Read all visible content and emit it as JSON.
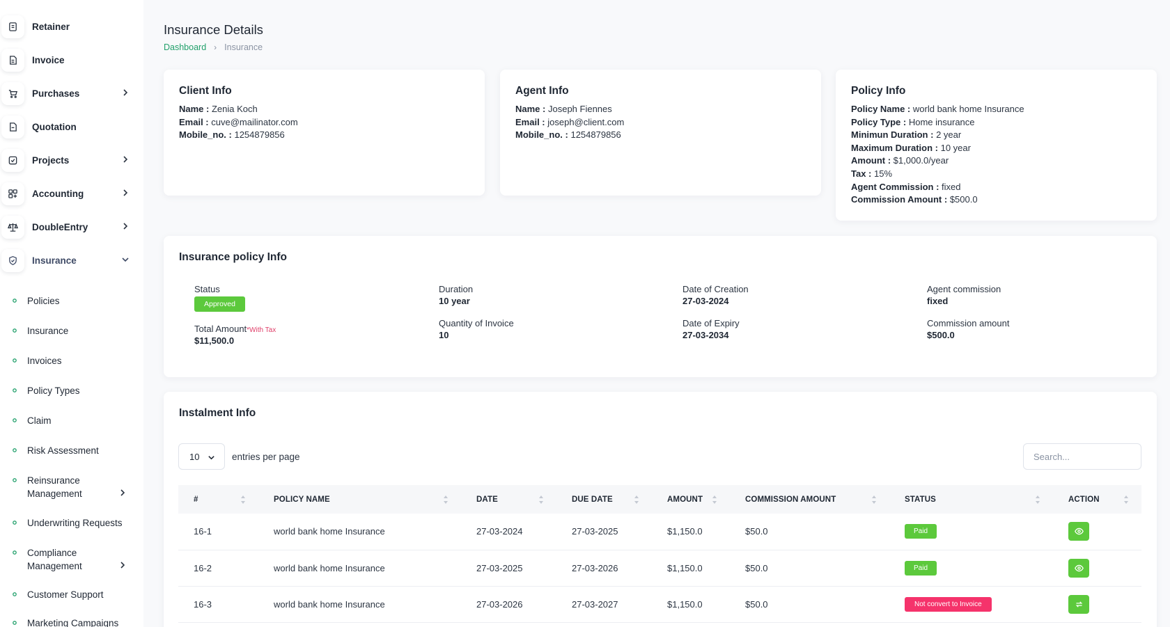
{
  "sidebar": {
    "items": [
      {
        "label": "Retainer",
        "icon": "retainer-icon"
      },
      {
        "label": "Invoice",
        "icon": "invoice-icon"
      },
      {
        "label": "Purchases",
        "icon": "cart-icon"
      },
      {
        "label": "Quotation",
        "icon": "quotation-icon"
      },
      {
        "label": "Projects",
        "icon": "projects-icon"
      },
      {
        "label": "Accounting",
        "icon": "accounting-icon"
      },
      {
        "label": "DoubleEntry",
        "icon": "scale-icon"
      },
      {
        "label": "Insurance",
        "icon": "shield-icon"
      }
    ],
    "sub_items": [
      {
        "label": "Policies"
      },
      {
        "label": "Insurance"
      },
      {
        "label": "Invoices"
      },
      {
        "label": "Policy Types"
      },
      {
        "label": "Claim"
      },
      {
        "label": "Risk Assessment"
      },
      {
        "label": "Reinsurance Management"
      },
      {
        "label": "Underwriting Requests"
      },
      {
        "label": "Compliance Management"
      },
      {
        "label": "Customer Support"
      },
      {
        "label": "Marketing Campaigns"
      }
    ]
  },
  "header": {
    "title": "Insurance Details",
    "breadcrumb": {
      "home": "Dashboard",
      "current": "Insurance"
    }
  },
  "client_info": {
    "title": "Client Info",
    "name_label": "Name :",
    "name": "Zenia Koch",
    "email_label": "Email :",
    "email": "cuve@mailinator.com",
    "mobile_label": "Mobile_no. :",
    "mobile": "1254879856"
  },
  "agent_info": {
    "title": "Agent Info",
    "name_label": "Name :",
    "name": "Joseph Fiennes",
    "email_label": "Email :",
    "email": "joseph@client.com",
    "mobile_label": "Mobile_no. :",
    "mobile": "1254879856"
  },
  "policy_info": {
    "title": "Policy Info",
    "rows": [
      {
        "label": "Policy Name :",
        "value": "world bank home Insurance"
      },
      {
        "label": "Policy Type :",
        "value": "Home insurance"
      },
      {
        "label": "Minimun Duration :",
        "value": "2 year"
      },
      {
        "label": "Maximum Duration :",
        "value": "10 year"
      },
      {
        "label": "Amount :",
        "value": "$1,000.0/year"
      },
      {
        "label": "Tax :",
        "value": "15%"
      },
      {
        "label": "Agent Commission :",
        "value": "fixed"
      },
      {
        "label": "Commission Amount :",
        "value": "$500.0"
      }
    ]
  },
  "policy_overview": {
    "title": "Insurance policy Info",
    "status_label": "Status",
    "status": "Approved",
    "total_label": "Total Amount",
    "total_tax_note": "*With Tax",
    "total": "$11,500.0",
    "duration_label": "Duration",
    "duration": "10 year",
    "qty_label": "Quantity of Invoice",
    "qty": "10",
    "created_label": "Date of Creation",
    "created": "27-03-2024",
    "expiry_label": "Date of Expiry",
    "expiry": "27-03-2034",
    "agent_comm_label": "Agent commission",
    "agent_comm": "fixed",
    "comm_amount_label": "Commission amount",
    "comm_amount": "$500.0"
  },
  "instalments": {
    "title": "Instalment Info",
    "per_page": "10",
    "per_page_label": "entries per page",
    "search_placeholder": "Search...",
    "columns": [
      "#",
      "POLICY NAME",
      "DATE",
      "DUE DATE",
      "AMOUNT",
      "COMMISSION AMOUNT",
      "STATUS",
      "ACTION"
    ],
    "rows": [
      {
        "id": "16-1",
        "policy": "world bank home Insurance",
        "date": "27-03-2024",
        "due": "27-03-2025",
        "amount": "$1,150.0",
        "commission": "$50.0",
        "status": "Paid",
        "action": "eye-icon"
      },
      {
        "id": "16-2",
        "policy": "world bank home Insurance",
        "date": "27-03-2025",
        "due": "27-03-2026",
        "amount": "$1,150.0",
        "commission": "$50.0",
        "status": "Paid",
        "action": "eye-icon"
      },
      {
        "id": "16-3",
        "policy": "world bank home Insurance",
        "date": "27-03-2026",
        "due": "27-03-2027",
        "amount": "$1,150.0",
        "commission": "$50.0",
        "status": "Not convert to Invoice",
        "action": "convert-icon"
      }
    ]
  },
  "colors": {
    "accent_green": "#22a06b",
    "badge_green": "#5cc93c",
    "badge_red": "#f5336b",
    "tax_note": "#e0406a"
  }
}
